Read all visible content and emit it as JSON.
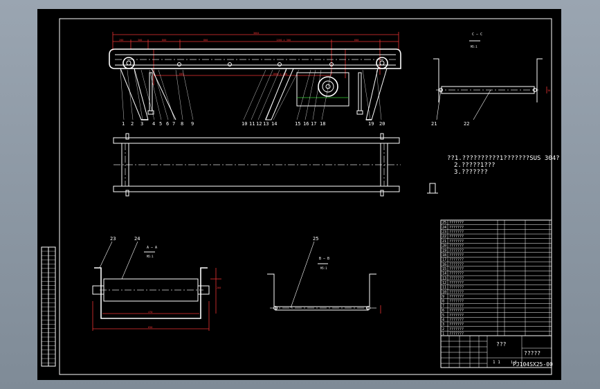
{
  "drawing": {
    "part_labels_main": [
      "1",
      "2",
      "3",
      "4",
      "5",
      "6",
      "7",
      "8",
      "9",
      "10",
      "11",
      "12",
      "13",
      "14",
      "15",
      "16",
      "17",
      "18",
      "19",
      "20"
    ],
    "part_labels_section": [
      "21",
      "22"
    ],
    "part_labels_roller": [
      "23",
      "24"
    ],
    "part_label_bracket": "25",
    "section_marks": {
      "cc": "C — C",
      "aa": "A — A",
      "bb": "B — B",
      "scale": "M5:1"
    },
    "dimensions": {
      "overall": "3604",
      "d1": "200",
      "d2": "300",
      "d3": "800",
      "d4": "800",
      "d5": "1200 ± 300",
      "d6": "600",
      "d7": "1000 ± 100",
      "roller_width": "470",
      "roller_outer": "650",
      "roller_h": "260",
      "section_h": "30"
    }
  },
  "notes": {
    "line1": "??1.??????????1???????SUS 304?",
    "line2": "2.?????1???",
    "line3": "3.???????"
  },
  "bom_rows": [
    {
      "no": "25",
      "name": "???????"
    },
    {
      "no": "24",
      "name": "???????"
    },
    {
      "no": "23",
      "name": "???????"
    },
    {
      "no": "22",
      "name": "???????"
    },
    {
      "no": "21",
      "name": "???????"
    },
    {
      "no": "20",
      "name": "???????"
    },
    {
      "no": "19",
      "name": "???????"
    },
    {
      "no": "18",
      "name": "???????"
    },
    {
      "no": "17",
      "name": "???????"
    },
    {
      "no": "16",
      "name": "???????"
    },
    {
      "no": "15",
      "name": "???????"
    },
    {
      "no": "14",
      "name": "???????"
    },
    {
      "no": "13",
      "name": "???????"
    },
    {
      "no": "12",
      "name": "???????"
    },
    {
      "no": "11",
      "name": "???????"
    },
    {
      "no": "10",
      "name": "???????"
    },
    {
      "no": "9",
      "name": "???????"
    },
    {
      "no": "8",
      "name": "???????"
    },
    {
      "no": "7",
      "name": "???????"
    },
    {
      "no": "6",
      "name": "???????"
    },
    {
      "no": "5",
      "name": "???????"
    },
    {
      "no": "4",
      "name": "???????"
    },
    {
      "no": "3",
      "name": "???????"
    },
    {
      "no": "2",
      "name": "???????"
    },
    {
      "no": "1",
      "name": "???????"
    }
  ],
  "title_block": {
    "title1": "???",
    "title2": "?????",
    "drawing_no": "PJ104SX25-00",
    "sheet_info": "1     1",
    "scale": "1:5",
    "qty": "1"
  }
}
